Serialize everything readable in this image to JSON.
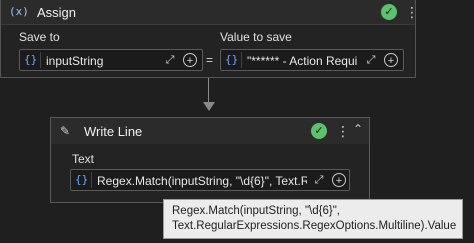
{
  "assign": {
    "icon": "(x)",
    "title": "Assign",
    "save_to_label": "Save to",
    "save_to_value": "inputString",
    "equals": "=",
    "value_label": "Value to save",
    "value_value": "\"****** - Action Requi",
    "brace_glyph": "{}",
    "status_icon": "check-circle-icon",
    "status_color": "#5cc26b"
  },
  "writeline": {
    "title": "Write Line",
    "text_label": "Text",
    "text_value": "Regex.Match(inputString, \"\\d{6}\", Text.Re",
    "brace_glyph": "{}",
    "status_icon": "check-circle-icon",
    "status_color": "#5cc26b"
  },
  "tooltip": {
    "line1": "Regex.Match(inputString, \"\\d{6}\",",
    "line2": "Text.RegularExpressions.RegexOptions.Multiline).Value"
  },
  "glyphs": {
    "check": "✓",
    "kebab": "⋮",
    "expand": "⤢",
    "plus": "+",
    "collapse": "⌃",
    "pen": "✎"
  }
}
